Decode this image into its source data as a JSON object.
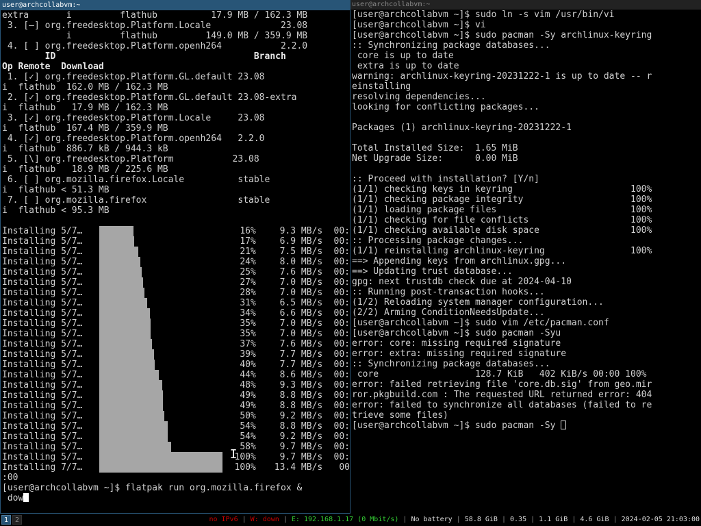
{
  "left_window": {
    "title": "user@archcollabvm:~",
    "lines_top": [
      "extra       i         flathub          17.9 MB / 162.3 MB",
      " 3. [—] org.freedesktop.Platform.Locale             23.08",
      "            i         flathub         149.0 MB / 359.9 MB",
      " 4. [ ] org.freedesktop.Platform.openh264           2.2.0"
    ],
    "header_line1": "        ID                                     Branch",
    "header_line2": "Op Remote  Download",
    "lines_mid": [
      " 1. [✓] org.freedesktop.Platform.GL.default 23.08",
      "i  flathub  162.0 MB / 162.3 MB",
      " 2. [✓] org.freedesktop.Platform.GL.default 23.08-extra",
      "i  flathub   17.9 MB / 162.3 MB",
      " 3. [✓] org.freedesktop.Platform.Locale     23.08",
      "i  flathub  167.4 MB / 359.9 MB",
      " 4. [✓] org.freedesktop.Platform.openh264   2.2.0",
      "i  flathub  886.7 kB / 944.3 kB",
      " 5. [\\] org.freedesktop.Platform           23.08",
      "i  flathub   18.9 MB / 225.6 MB",
      " 6. [ ] org.mozilla.firefox.Locale          stable",
      "i  flathub < 51.3 MB",
      " 7. [ ] org.mozilla.firefox                 stable",
      "i  flathub < 95.3 MB",
      ""
    ],
    "progress": [
      {
        "label": "Installing 5/7…",
        "fraction": 0.16,
        "pct": "16%",
        "speed": "9.3 MB/s",
        "eta": "00:"
      },
      {
        "label": "Installing 5/7…",
        "fraction": 0.17,
        "pct": "17%",
        "speed": "6.9 MB/s",
        "eta": "00:"
      },
      {
        "label": "Installing 5/7…",
        "fraction": 0.21,
        "pct": "21%",
        "speed": "7.5 MB/s",
        "eta": "00:"
      },
      {
        "label": "Installing 5/7…",
        "fraction": 0.24,
        "pct": "24%",
        "speed": "8.0 MB/s",
        "eta": "00:"
      },
      {
        "label": "Installing 5/7…",
        "fraction": 0.25,
        "pct": "25%",
        "speed": "7.6 MB/s",
        "eta": "00:"
      },
      {
        "label": "Installing 5/7…",
        "fraction": 0.27,
        "pct": "27%",
        "speed": "7.0 MB/s",
        "eta": "00:"
      },
      {
        "label": "Installing 5/7…",
        "fraction": 0.28,
        "pct": "28%",
        "speed": "7.0 MB/s",
        "eta": "00:"
      },
      {
        "label": "Installing 5/7…",
        "fraction": 0.31,
        "pct": "31%",
        "speed": "6.5 MB/s",
        "eta": "00:"
      },
      {
        "label": "Installing 5/7…",
        "fraction": 0.34,
        "pct": "34%",
        "speed": "6.6 MB/s",
        "eta": "00:"
      },
      {
        "label": "Installing 5/7…",
        "fraction": 0.35,
        "pct": "35%",
        "speed": "7.0 MB/s",
        "eta": "00:"
      },
      {
        "label": "Installing 5/7…",
        "fraction": 0.35,
        "pct": "35%",
        "speed": "7.0 MB/s",
        "eta": "00:"
      },
      {
        "label": "Installing 5/7…",
        "fraction": 0.37,
        "pct": "37%",
        "speed": "7.6 MB/s",
        "eta": "00:"
      },
      {
        "label": "Installing 5/7…",
        "fraction": 0.39,
        "pct": "39%",
        "speed": "7.7 MB/s",
        "eta": "00:"
      },
      {
        "label": "Installing 5/7…",
        "fraction": 0.4,
        "pct": "40%",
        "speed": "7.7 MB/s",
        "eta": "00:"
      },
      {
        "label": "Installing 5/7…",
        "fraction": 0.44,
        "pct": "44%",
        "speed": "8.6 MB/s",
        "eta": "00:"
      },
      {
        "label": "Installing 5/7…",
        "fraction": 0.48,
        "pct": "48%",
        "speed": "9.3 MB/s",
        "eta": "00:"
      },
      {
        "label": "Installing 5/7…",
        "fraction": 0.49,
        "pct": "49%",
        "speed": "8.8 MB/s",
        "eta": "00:"
      },
      {
        "label": "Installing 5/7…",
        "fraction": 0.49,
        "pct": "49%",
        "speed": "8.8 MB/s",
        "eta": "00:"
      },
      {
        "label": "Installing 5/7…",
        "fraction": 0.5,
        "pct": "50%",
        "speed": "9.2 MB/s",
        "eta": "00:"
      },
      {
        "label": "Installing 5/7…",
        "fraction": 0.54,
        "pct": "54%",
        "speed": "8.8 MB/s",
        "eta": "00:"
      },
      {
        "label": "Installing 5/7…",
        "fraction": 0.54,
        "pct": "54%",
        "speed": "9.2 MB/s",
        "eta": "00:"
      },
      {
        "label": "Installing 5/7…",
        "fraction": 0.58,
        "pct": "58%",
        "speed": "9.7 MB/s",
        "eta": "00:"
      },
      {
        "label": "Installing 5/7…",
        "fraction": 1.0,
        "pct": "100%",
        "speed": "9.7 MB/s",
        "eta": "00:"
      },
      {
        "label": "Installing 7/7…",
        "fraction": 1.0,
        "pct": "100%",
        "speed": "13.4 MB/s",
        "eta": "00"
      }
    ],
    "lines_bottom": [
      ":00",
      "[user@archcollabvm ~]$ flatpak run org.mozilla.firefox &"
    ],
    "input_text": " dow"
  },
  "right_window": {
    "title": "user@archcollabvm:~",
    "lines": [
      "[user@archcollabvm ~]$ sudo ln -s vim /usr/bin/vi",
      "[user@archcollabvm ~]$ vi",
      "[user@archcollabvm ~]$ sudo pacman -Sy archlinux-keyring",
      ":: Synchronizing package databases...",
      " core is up to date",
      " extra is up to date",
      "warning: archlinux-keyring-20231222-1 is up to date -- r",
      "einstalling",
      "resolving dependencies...",
      "looking for conflicting packages...",
      "",
      "Packages (1) archlinux-keyring-20231222-1",
      "",
      "Total Installed Size:  1.65 MiB",
      "Net Upgrade Size:      0.00 MiB",
      "",
      ":: Proceed with installation? [Y/n]",
      "(1/1) checking keys in keyring                      100%",
      "(1/1) checking package integrity                    100%",
      "(1/1) loading package files                         100%",
      "(1/1) checking for file conflicts                   100%",
      "(1/1) checking available disk space                 100%",
      ":: Processing package changes...",
      "(1/1) reinstalling archlinux-keyring                100%",
      "==> Appending keys from archlinux.gpg...",
      "==> Updating trust database...",
      "gpg: next trustdb check due at 2024-04-10",
      ":: Running post-transaction hooks...",
      "(1/2) Reloading system manager configuration...",
      "(2/2) Arming ConditionNeedsUpdate...",
      "[user@archcollabvm ~]$ sudo vim /etc/pacman.conf",
      "[user@archcollabvm ~]$ sudo pacman -Syu",
      "error: core: missing required signature",
      "error: extra: missing required signature",
      ":: Synchronizing package databases...",
      " core                  128.7 KiB   402 KiB/s 00:00 100%",
      "error: failed retrieving file 'core.db.sig' from geo.mir",
      "ror.pkgbuild.com : The requested URL returned error: 404",
      "error: failed to synchronize all databases (failed to re",
      "trieve some files)"
    ],
    "prompt_line": "[user@archcollabvm ~]$ sudo pacman -Sy "
  },
  "statusbar": {
    "workspaces": [
      "1",
      "2"
    ],
    "ipv6": "no IPv6",
    "wifi": "W: down",
    "ethernet": "E: 192.168.1.17 (0 Mbit/s)",
    "battery": "No battery",
    "disk": "58.8 GiB",
    "load": "0.35",
    "memory": "1.1 GiB",
    "swap": "4.6 GiB",
    "datetime": "2024-02-05 21:03:00",
    "colors": {
      "down": "#cc0000",
      "up": "#33cc33",
      "focus": "#285577"
    }
  }
}
